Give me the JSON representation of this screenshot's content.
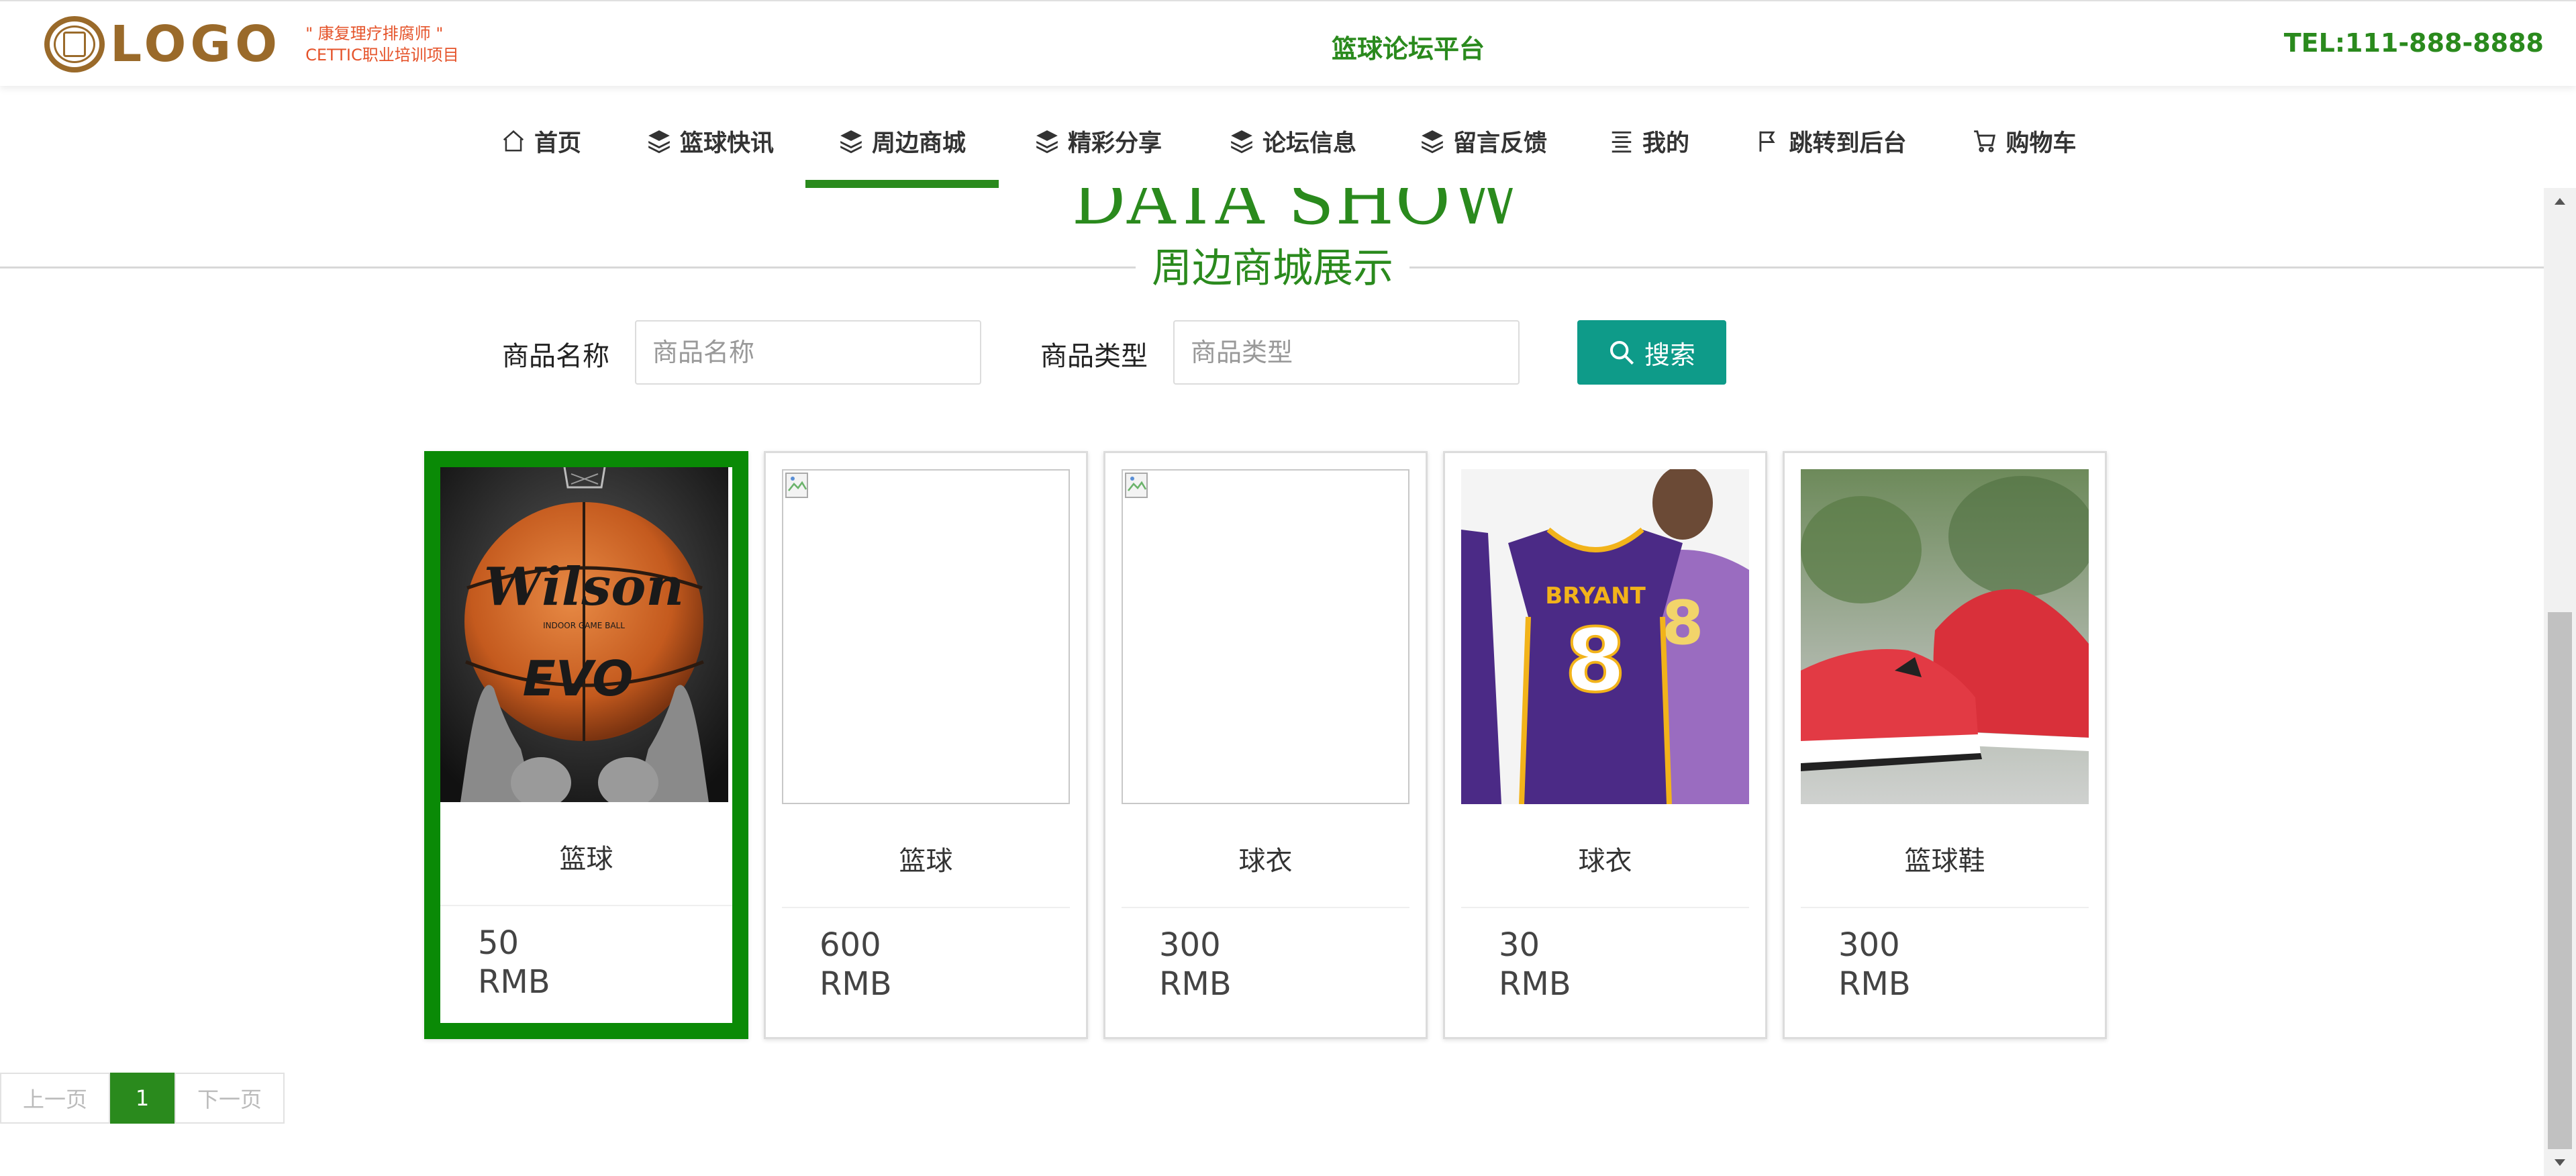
{
  "header": {
    "logo_text": "LOGO",
    "logo_sub_1": "\" 康复理疗排腐师 \"",
    "logo_sub_2": "CETTIC职业培训项目",
    "site_title": "篮球论坛平台",
    "tel": "TEL:111-888-8888"
  },
  "nav": {
    "items": [
      {
        "label": "首页",
        "icon": "home-icon"
      },
      {
        "label": "篮球快讯",
        "icon": "layers-icon"
      },
      {
        "label": "周边商城",
        "icon": "layers-icon"
      },
      {
        "label": "精彩分享",
        "icon": "layers-icon"
      },
      {
        "label": "论坛信息",
        "icon": "layers-icon"
      },
      {
        "label": "留言反馈",
        "icon": "layers-icon"
      },
      {
        "label": "我的",
        "icon": "list-icon"
      },
      {
        "label": "跳转到后台",
        "icon": "flag-icon"
      },
      {
        "label": "购物车",
        "icon": "cart-icon"
      }
    ],
    "active": "周边商城"
  },
  "section": {
    "title_en": "DATA SHOW",
    "title_cn": "周边商城展示"
  },
  "search": {
    "name_label": "商品名称",
    "name_placeholder": "商品名称",
    "type_label": "商品类型",
    "type_placeholder": "商品类型",
    "button_label": "搜索"
  },
  "products": [
    {
      "name": "篮球",
      "price": "50",
      "currency": "RMB",
      "image": "basketball-photo",
      "active": true
    },
    {
      "name": "篮球",
      "price": "600",
      "currency": "RMB",
      "image": "broken-image",
      "active": false
    },
    {
      "name": "球衣",
      "price": "300",
      "currency": "RMB",
      "image": "broken-image",
      "active": false
    },
    {
      "name": "球衣",
      "price": "30",
      "currency": "RMB",
      "image": "jersey-photo",
      "active": false
    },
    {
      "name": "篮球鞋",
      "price": "300",
      "currency": "RMB",
      "image": "shoes-photo",
      "active": false
    }
  ],
  "pagination": {
    "prev": "上一页",
    "current": "1",
    "next": "下一页"
  },
  "colors": {
    "brand_green": "#2a8a1d",
    "active_card_border": "#0a8a06",
    "search_button": "#0e9b89",
    "logo_brown": "#9a6a2a"
  }
}
